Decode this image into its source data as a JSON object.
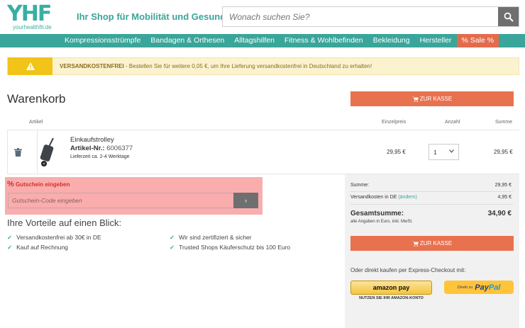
{
  "header": {
    "logo_text": "YHF",
    "logo_sub": "yourhealthfit.de",
    "tagline": "Ihr Shop für Mobilität und Gesundheit",
    "search_placeholder": "Wonach suchen Sie?",
    "search_icon": "search-icon"
  },
  "nav": {
    "items": [
      {
        "label": "Kompressionsstrümpfe"
      },
      {
        "label": "Bandagen & Orthesen"
      },
      {
        "label": "Alltagshilfen"
      },
      {
        "label": "Fitness & Wohlbefinden"
      },
      {
        "label": "Bekleidung"
      },
      {
        "label": "Hersteller"
      },
      {
        "label": "% Sale %"
      }
    ],
    "colors": {
      "bar": "#3aa59a",
      "sale": "#e36b4d"
    }
  },
  "notice": {
    "strong": "VERSANDKOSTENFREI",
    "text": " - Bestellen Sie für weitere 0,05 €, um Ihre Lieferung versandkostenfrei in Deutschland zu erhalten!",
    "icon": "warning-icon"
  },
  "cart": {
    "title": "Warenkorb",
    "checkout_label": "ZUR KASSE",
    "columns": {
      "article": "Artikel",
      "unit_price": "Einzelpreis",
      "quantity": "Anzahl",
      "sum": "Summe"
    },
    "items": [
      {
        "name": "Einkaufstrolley",
        "article_label": "Artikel-Nr.:",
        "article_no": "6006377",
        "delivery": "Lieferzeit ca. 2-4 Werktage",
        "unit_price": "29,95 €",
        "quantity": "1",
        "sum": "29,95 €"
      }
    ]
  },
  "coupon": {
    "label": "Gutschein eingeben",
    "placeholder": "Gutschein-Code eingeben",
    "button": "›"
  },
  "advantages": {
    "title": "Ihre Vorteile auf einen Blick:",
    "items": [
      "Versandkostenfrei ab 30€ in DE",
      "Kauf auf Rechnung",
      "Wir sind zertifiziert & sicher",
      "Trusted Shops Käuferschutz bis 100 Euro"
    ]
  },
  "summary": {
    "subtotal_label": "Summe:",
    "subtotal": "29,95 €",
    "shipping_label": "Versandkosten in DE",
    "shipping_change": "(ändern)",
    "shipping": "4,95 €",
    "total_label": "Gesamtsumme:",
    "total_note": "alle Angaben in Euro, inkl. MwSt.",
    "total": "34,90 €",
    "checkout_label": "ZUR KASSE",
    "express_label": "Oder direkt kaufen per Express-Checkout mit:",
    "amazon_label": "amazon pay",
    "amazon_sub": "NUTZEN SIE IHR AMAZON-KONTO",
    "paypal_pre": "Direkt zu",
    "paypal_label_a": "Pay",
    "paypal_label_b": "Pal"
  }
}
